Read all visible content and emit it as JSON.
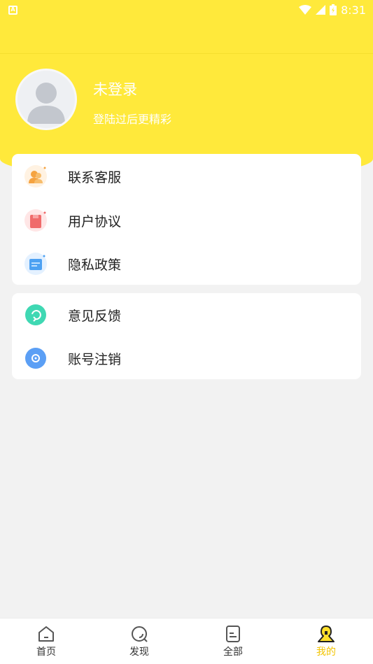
{
  "status_bar": {
    "time": "8:31",
    "left_icon_letter": "A"
  },
  "profile": {
    "title": "未登录",
    "subtitle": "登陆过后更精彩"
  },
  "menu_group_1": [
    {
      "label": "联系客服",
      "icon": "customer-service-icon"
    },
    {
      "label": "用户协议",
      "icon": "user-agreement-icon"
    },
    {
      "label": "隐私政策",
      "icon": "privacy-policy-icon"
    }
  ],
  "menu_group_2": [
    {
      "label": "意见反馈",
      "icon": "feedback-icon"
    },
    {
      "label": "账号注销",
      "icon": "account-cancel-icon"
    }
  ],
  "tabs": [
    {
      "label": "首页",
      "icon": "home-icon",
      "active": false
    },
    {
      "label": "发现",
      "icon": "discover-icon",
      "active": false
    },
    {
      "label": "全部",
      "icon": "all-icon",
      "active": false
    },
    {
      "label": "我的",
      "icon": "mine-icon",
      "active": true
    }
  ],
  "colors": {
    "accent": "#ffe93b",
    "active_tab": "#f2c400",
    "background": "#f2f2f2"
  }
}
